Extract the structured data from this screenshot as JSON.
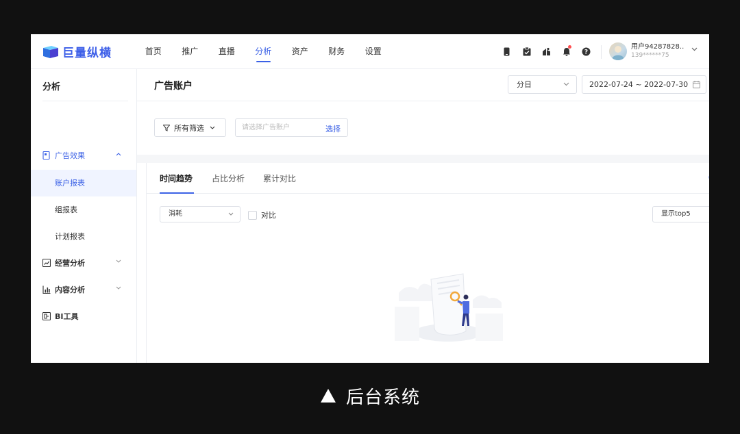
{
  "brand": {
    "name": "巨量纵横",
    "color": "#3d5fe8"
  },
  "nav": {
    "items": [
      {
        "label": "首页"
      },
      {
        "label": "推广"
      },
      {
        "label": "直播"
      },
      {
        "label": "分析",
        "active": true
      },
      {
        "label": "资产"
      },
      {
        "label": "财务"
      },
      {
        "label": "设置"
      }
    ]
  },
  "toolbar_icons": [
    "phone-icon",
    "clipboard-icon",
    "gift-icon",
    "bell-icon",
    "help-icon"
  ],
  "user": {
    "name": "用户94287828...",
    "phone": "139******75"
  },
  "sidebar": {
    "title": "分析",
    "groups": [
      {
        "label": "广告效果",
        "icon": "doc-icon",
        "open": true,
        "children": [
          {
            "label": "账户报表",
            "active": true
          },
          {
            "label": "组报表"
          },
          {
            "label": "计划报表"
          }
        ]
      },
      {
        "label": "经营分析",
        "icon": "chart-board-icon"
      },
      {
        "label": "内容分析",
        "icon": "bar-chart-icon"
      },
      {
        "label": "BI工具",
        "icon": "bi-icon"
      }
    ]
  },
  "page": {
    "title": "广告账户",
    "granularity": "分日",
    "date_range": "2022-07-24 ~ 2022-07-30"
  },
  "filter": {
    "all_filters": "所有筛选",
    "account_placeholder": "请选择广告账户",
    "select_label": "选择"
  },
  "card": {
    "tabs": [
      {
        "label": "时间趋势",
        "active": true
      },
      {
        "label": "占比分析"
      },
      {
        "label": "累计对比"
      }
    ],
    "metric": "消耗",
    "compare_label": "对比",
    "top_selector": "显示top5"
  },
  "caption": "后台系统",
  "colors": {
    "accent": "#3b61e6",
    "background": "#111111",
    "notice_dot": "#ff4d4f"
  }
}
